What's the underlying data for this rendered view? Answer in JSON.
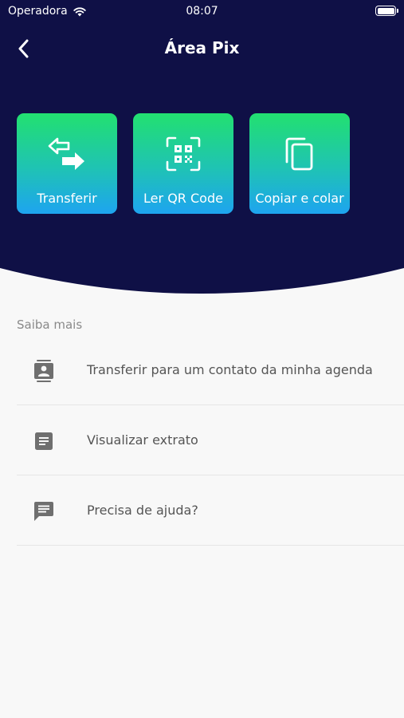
{
  "status_bar": {
    "carrier": "Operadora",
    "time": "08:07"
  },
  "nav": {
    "title": "Área Pix"
  },
  "actions": [
    {
      "label": "Transferir",
      "icon": "transfer-arrows-icon"
    },
    {
      "label": "Ler QR Code",
      "icon": "qr-code-scan-icon"
    },
    {
      "label": "Copiar e colar",
      "icon": "copy-paste-icon"
    }
  ],
  "section": {
    "title": "Saiba mais"
  },
  "items": [
    {
      "label": "Transferir para um contato da minha agenda",
      "icon": "contact-book-icon"
    },
    {
      "label": "Visualizar extrato",
      "icon": "statement-document-icon"
    },
    {
      "label": "Precisa de ajuda?",
      "icon": "chat-help-icon"
    }
  ],
  "colors": {
    "header_bg": "#0f1046",
    "page_bg": "#f8f8f8",
    "card_gradient_top": "#22e070",
    "card_gradient_bottom": "#1ea4f0",
    "icon_gray": "#6f6f6f"
  }
}
